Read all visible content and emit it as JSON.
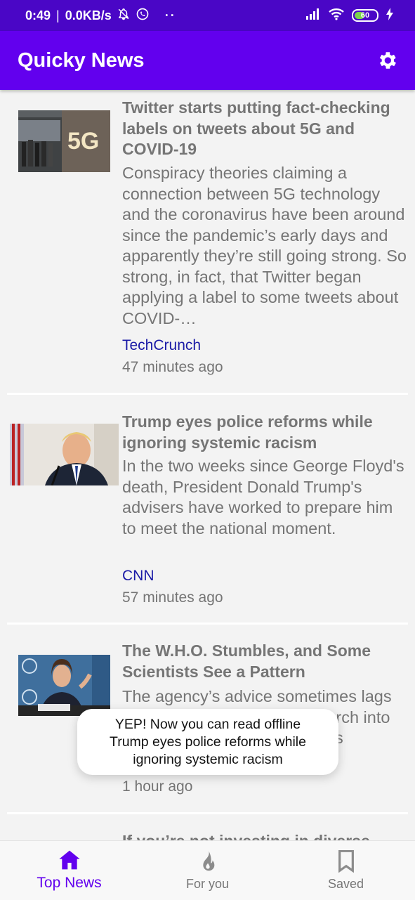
{
  "status_bar": {
    "time": "0:49",
    "speed": "0.0KB/s",
    "battery": "60",
    "icons": [
      "bell-off-icon",
      "whatsapp-icon",
      "dots-icon",
      "signal-icon",
      "wifi-icon",
      "battery-icon",
      "charging-icon"
    ]
  },
  "app_bar": {
    "title": "Quicky News",
    "settings_icon": "gear-icon"
  },
  "articles": [
    {
      "headline": "Twitter starts putting fact-checking labels on tweets about 5G and COVID-19",
      "summary": "Conspiracy theories claiming a connection between 5G technology and the coronavirus have been around since the pandemic’s early days and apparently they’re still going strong. So strong, in fact, that Twitter began applying a label to some tweets about COVID-…",
      "source": "TechCrunch",
      "time": "47 minutes ago",
      "thumb_text": "5G"
    },
    {
      "headline": "Trump eyes police reforms while ignoring systemic racism",
      "summary": "In the two weeks since George Floyd's death, President Donald Trump's advisers have worked to prepare him to meet the national moment.",
      "source": "CNN",
      "time": "57 minutes ago"
    },
    {
      "headline": "The W.H.O. Stumbles, and Some Scientists See a Pattern",
      "summary": "The agency’s advice sometimes lags behind rapidly evolving research into the coronavirus, some experts contend.",
      "time": "1 hour ago"
    },
    {
      "headline": "If you’re not investing in diverse"
    }
  ],
  "toast": {
    "line1": "YEP! Now you can read offline",
    "line2": "Trump eyes police reforms while",
    "line3": "ignoring systemic racism"
  },
  "bottom_nav": [
    {
      "label": "Top News",
      "icon": "home-icon",
      "active": true
    },
    {
      "label": "For you",
      "icon": "flame-icon",
      "active": false
    },
    {
      "label": "Saved",
      "icon": "bookmark-icon",
      "active": false
    }
  ],
  "colors": {
    "status_bar": "#4a06c6",
    "primary": "#6200ee",
    "source_link": "#1a1aa6",
    "text_gray": "#757575"
  }
}
